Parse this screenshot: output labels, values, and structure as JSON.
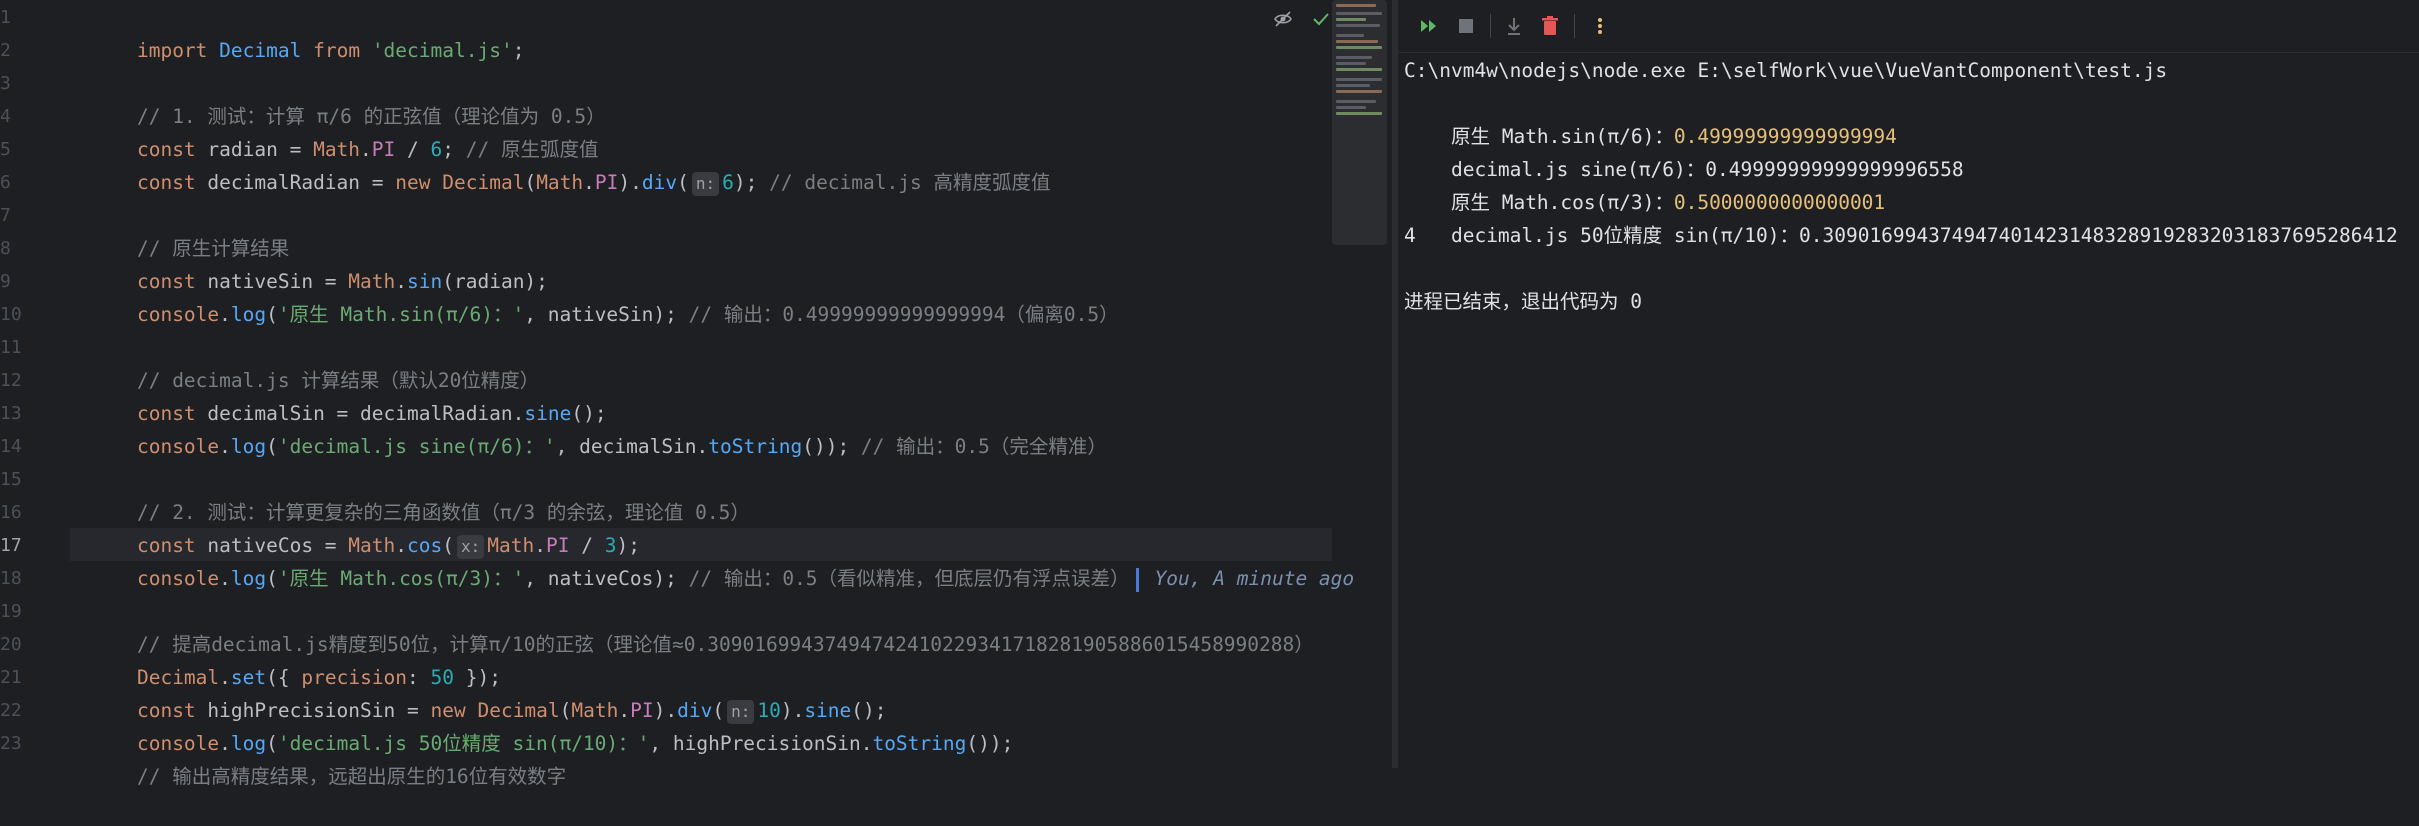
{
  "editor": {
    "active_line": "17",
    "line_numbers": [
      "1",
      "2",
      "3",
      "4",
      "5",
      "6",
      "7",
      "8",
      "9",
      "10",
      "11",
      "12",
      "13",
      "14",
      "15",
      "16",
      "17",
      "18",
      "19",
      "20",
      "21",
      "22",
      "23"
    ],
    "lines": {
      "l1": {
        "a": "import",
        "b": " Decimal ",
        "c": "from",
        "d": " ",
        "e": "'decimal.js'",
        "f": ";"
      },
      "l3": {
        "a": "// 1. 测试：计算 π/6 的正弦值（理论值为 0.5）"
      },
      "l4": {
        "a": "const",
        "b": " radian = ",
        "c": "Math",
        "d": ".",
        "e": "PI",
        "f": " / ",
        "g": "6",
        "h": "; ",
        "i": "// 原生弧度值"
      },
      "l5": {
        "a": "const",
        "b": " decimalRadian = ",
        "c": "new",
        "d": " ",
        "e": "Decimal",
        "f": "(",
        "g": "Math",
        "h": ".",
        "i": "PI",
        "j": ").",
        "k": "div",
        "l": "(",
        "m": "n:",
        "n": "6",
        "o": "); ",
        "p": "// decimal.js 高精度弧度值"
      },
      "l7": {
        "a": "// 原生计算结果"
      },
      "l8": {
        "a": "const",
        "b": " nativeSin = ",
        "c": "Math",
        "d": ".",
        "e": "sin",
        "f": "(radian);"
      },
      "l9": {
        "a": "console",
        "b": ".",
        "c": "log",
        "d": "(",
        "e": "'原生 Math.sin(π/6)：'",
        "f": ", nativeSin); ",
        "g": "// 输出：0.49999999999999994（偏离0.5）"
      },
      "l11": {
        "a": "// decimal.js 计算结果（默认20位精度）"
      },
      "l12": {
        "a": "const",
        "b": " decimalSin = decimalRadian.",
        "c": "sine",
        "d": "();"
      },
      "l13": {
        "a": "console",
        "b": ".",
        "c": "log",
        "d": "(",
        "e": "'decimal.js sine(π/6)：'",
        "f": ", decimalSin.",
        "g": "toString",
        "h": "()); ",
        "i": "// 输出：0.5（完全精准）"
      },
      "l15": {
        "a": "// 2. 测试：计算更复杂的三角函数值（π/3 的余弦，理论值 0.5）"
      },
      "l16": {
        "a": "const",
        "b": " nativeCos = ",
        "c": "Math",
        "d": ".",
        "e": "cos",
        "f": "(",
        "g": "x:",
        "h": "Math",
        "i": ".",
        "j": "PI",
        "k": " / ",
        "l": "3",
        "m": ");"
      },
      "l17": {
        "a": "console",
        "b": ".",
        "c": "log",
        "d": "(",
        "e": "'原生 Math.cos(π/3)：'",
        "f": ", nativeCos); ",
        "g": "// 输出：0.5（看似精准，但底层仍有浮点误差）",
        "h": "You, A minute ago"
      },
      "l19": {
        "a": "// 提高decimal.js精度到50位，计算π/10的正弦（理论值≈0.30901699437494742410229341718281905886015458990288）"
      },
      "l20": {
        "a": "Decimal",
        "b": ".",
        "c": "set",
        "d": "({ ",
        "e": "precision",
        "f": ": ",
        "g": "50",
        "h": " });"
      },
      "l21": {
        "a": "const",
        "b": " highPrecisionSin = ",
        "c": "new",
        "d": " ",
        "e": "Decimal",
        "f": "(",
        "g": "Math",
        "h": ".",
        "i": "PI",
        "j": ").",
        "k": "div",
        "l": "(",
        "m": "n:",
        "n": "10",
        "o": ").",
        "p": "sine",
        "q": "();"
      },
      "l22": {
        "a": "console",
        "b": ".",
        "c": "log",
        "d": "(",
        "e": "'decimal.js 50位精度 sin(π/10)：'",
        "f": ", highPrecisionSin.",
        "g": "toString",
        "h": "());"
      },
      "l23": {
        "a": "// 输出高精度结果，远超出原生的16位有效数字"
      }
    }
  },
  "console": {
    "command": "C:\\nvm4w\\nodejs\\node.exe E:\\selfWork\\vue\\VueVantComponent\\test.js",
    "out1_label": "原生 Math.sin(π/6)：",
    "out1_value": "0.49999999999999994",
    "out2_label": "decimal.js sine(π/6)：",
    "out2_value": "0.49999999999999996558",
    "out3_label": "原生 Math.cos(π/3)：",
    "out3_value": "0.5000000000000001",
    "out4_label": "decimal.js 50位精度 sin(π/10)：",
    "out4_value": "0.3090169943749474014231483289192832031837695286412",
    "out4_wrap": "4",
    "exit_message": "进程已结束，退出代码为 0"
  },
  "colors": {
    "keyword": "#cf8e6d",
    "string": "#6aab73",
    "comment": "#7a7e85",
    "number": "#2aacb8",
    "function": "#56a8f5",
    "output_value": "#e5c07b"
  }
}
